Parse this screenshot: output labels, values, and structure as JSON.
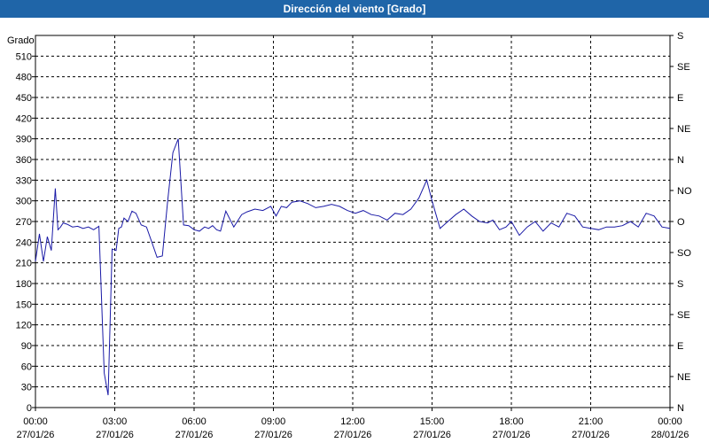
{
  "window": {
    "title": "Dirección del viento [Grado]"
  },
  "colors": {
    "header": "#1f65a8",
    "line": "#1a1aa6",
    "grid": "#000000"
  },
  "chart_data": {
    "type": "line",
    "title": "Dirección del viento [Grado]",
    "ylabel": "Grado",
    "ylim": [
      0,
      540
    ],
    "yticks": [
      0,
      30,
      60,
      90,
      120,
      150,
      180,
      210,
      240,
      270,
      300,
      330,
      360,
      390,
      420,
      450,
      480,
      510
    ],
    "right_axis_labels": [
      "N",
      "NE",
      "E",
      "SE",
      "S",
      "SO",
      "O",
      "NO",
      "N",
      "NE",
      "E",
      "SE",
      "S"
    ],
    "x_tick_labels": [
      {
        "time": "00:00",
        "date": "27/01/26"
      },
      {
        "time": "03:00",
        "date": "27/01/26"
      },
      {
        "time": "06:00",
        "date": "27/01/26"
      },
      {
        "time": "09:00",
        "date": "27/01/26"
      },
      {
        "time": "12:00",
        "date": "27/01/26"
      },
      {
        "time": "15:00",
        "date": "27/01/26"
      },
      {
        "time": "18:00",
        "date": "27/01/26"
      },
      {
        "time": "21:00",
        "date": "27/01/26"
      },
      {
        "time": "00:00",
        "date": "28/01/26"
      }
    ],
    "xlim_hours": [
      0,
      24
    ],
    "grid": true,
    "series": [
      {
        "x_hours": [
          0.0,
          0.15,
          0.3,
          0.45,
          0.6,
          0.75,
          0.85,
          0.95,
          1.05,
          1.2,
          1.4,
          1.6,
          1.8,
          2.0,
          2.2,
          2.4,
          2.6,
          2.75,
          2.9,
          3.05,
          3.15,
          3.25,
          3.35,
          3.5,
          3.65,
          3.8,
          4.0,
          4.2,
          4.4,
          4.6,
          4.8,
          5.0,
          5.2,
          5.4,
          5.6,
          5.8,
          6.0,
          6.2,
          6.4,
          6.55,
          6.7,
          6.85,
          7.0,
          7.2,
          7.5,
          7.8,
          8.0,
          8.3,
          8.6,
          8.9,
          9.1,
          9.3,
          9.5,
          9.7,
          10.0,
          10.3,
          10.6,
          10.9,
          11.2,
          11.5,
          11.8,
          12.1,
          12.4,
          12.7,
          13.0,
          13.3,
          13.6,
          13.9,
          14.2,
          14.5,
          14.8,
          15.0,
          15.3,
          15.6,
          15.9,
          16.2,
          16.5,
          16.8,
          17.1,
          17.3,
          17.55,
          17.8,
          18.0,
          18.3,
          18.6,
          18.9,
          19.2,
          19.5,
          19.8,
          20.1,
          20.4,
          20.7,
          21.0,
          21.3,
          21.6,
          21.9,
          22.2,
          22.5,
          22.8,
          23.1,
          23.4,
          23.7,
          24.0
        ],
        "values": [
          212,
          252,
          212,
          248,
          228,
          318,
          258,
          262,
          268,
          266,
          262,
          263,
          260,
          262,
          258,
          263,
          50,
          18,
          230,
          228,
          260,
          262,
          275,
          270,
          285,
          282,
          265,
          262,
          240,
          218,
          220,
          300,
          370,
          390,
          265,
          264,
          258,
          256,
          262,
          260,
          264,
          258,
          256,
          285,
          262,
          280,
          284,
          288,
          286,
          292,
          278,
          292,
          290,
          298,
          300,
          296,
          290,
          292,
          295,
          292,
          286,
          282,
          286,
          280,
          278,
          272,
          282,
          280,
          288,
          304,
          330,
          300,
          260,
          270,
          280,
          288,
          278,
          270,
          268,
          272,
          258,
          262,
          270,
          250,
          262,
          270,
          256,
          268,
          262,
          282,
          278,
          262,
          260,
          258,
          262,
          262,
          264,
          270,
          262,
          282,
          278,
          262,
          260
        ]
      }
    ]
  }
}
